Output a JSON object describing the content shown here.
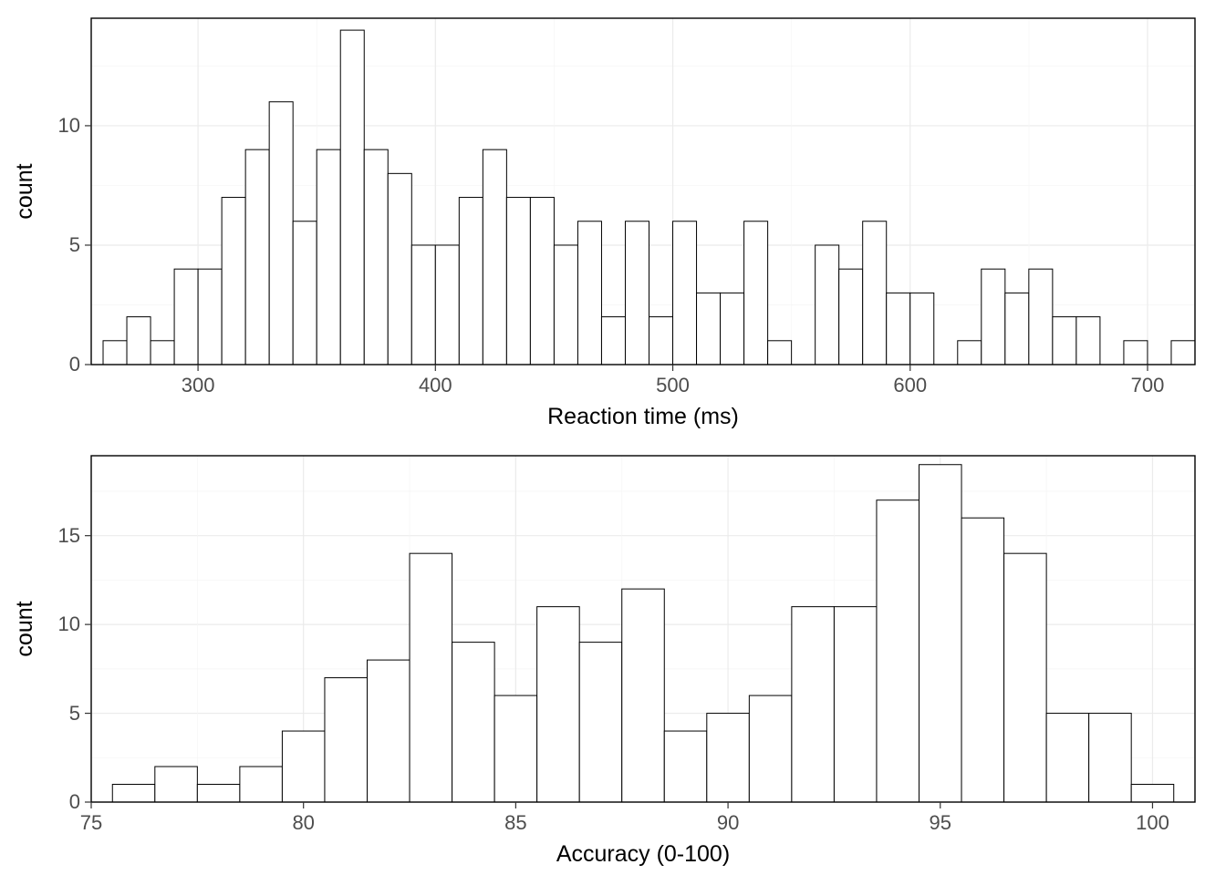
{
  "chart_data": [
    {
      "type": "bar",
      "xlabel": "Reaction time (ms)",
      "ylabel": "count",
      "xlim": [
        255,
        720
      ],
      "ylim": [
        0,
        14.5
      ],
      "xticks": [
        300,
        400,
        500,
        600,
        700
      ],
      "yticks": [
        0,
        5,
        10
      ],
      "binwidth": 10,
      "categories": [
        260,
        270,
        280,
        290,
        300,
        310,
        320,
        330,
        340,
        350,
        360,
        370,
        380,
        390,
        400,
        410,
        420,
        430,
        440,
        450,
        460,
        470,
        480,
        490,
        500,
        510,
        520,
        530,
        540,
        550,
        560,
        570,
        580,
        590,
        600,
        610,
        620,
        630,
        640,
        650,
        660,
        670,
        680,
        690,
        700,
        710
      ],
      "values": [
        1,
        2,
        1,
        4,
        4,
        7,
        9,
        11,
        6,
        9,
        14,
        9,
        8,
        5,
        5,
        7,
        9,
        7,
        7,
        5,
        6,
        2,
        6,
        2,
        6,
        3,
        3,
        6,
        1,
        0,
        5,
        4,
        6,
        3,
        3,
        0,
        1,
        4,
        3,
        4,
        2,
        2,
        0,
        1,
        0,
        1
      ]
    },
    {
      "type": "bar",
      "xlabel": "Accuracy (0-100)",
      "ylabel": "count",
      "xlim": [
        75,
        101
      ],
      "ylim": [
        0,
        19.5
      ],
      "xticks": [
        75,
        80,
        85,
        90,
        95,
        100
      ],
      "yticks": [
        0,
        5,
        10,
        15
      ],
      "binwidth": 1,
      "categories": [
        76,
        77,
        78,
        79,
        80,
        81,
        82,
        83,
        84,
        85,
        86,
        87,
        88,
        89,
        90,
        91,
        92,
        93,
        94,
        95,
        96,
        97,
        98,
        99,
        100
      ],
      "values": [
        1,
        2,
        1,
        2,
        4,
        7,
        8,
        14,
        9,
        6,
        11,
        9,
        12,
        4,
        5,
        6,
        11,
        11,
        17,
        19,
        16,
        14,
        5,
        5,
        1
      ]
    }
  ]
}
